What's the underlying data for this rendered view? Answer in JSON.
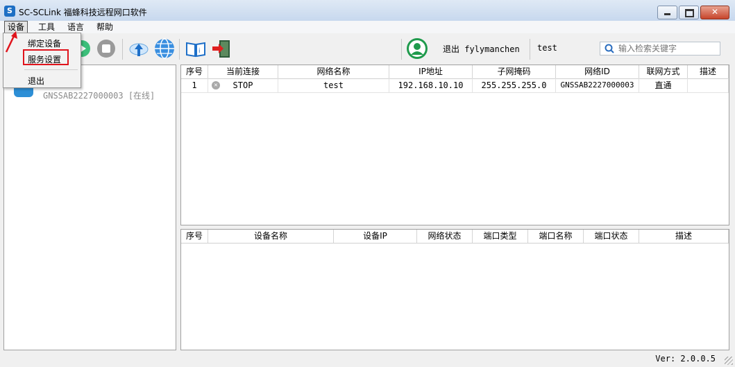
{
  "window": {
    "title": "SC-SCLink 福蜂科技远程网口软件",
    "icon_letter": "S"
  },
  "menubar": {
    "items": [
      "设备",
      "工具",
      "语言",
      "帮助"
    ]
  },
  "dropdown": {
    "items": [
      "绑定设备",
      "服务设置",
      "退出"
    ],
    "highlighted": "服务设置",
    "highlight_color": "#e0141c"
  },
  "toolbar": {
    "icons": [
      "play-icon",
      "stop-icon",
      "upload-icon",
      "globe-icon",
      "manual-icon",
      "exit-icon",
      "user-avatar-icon"
    ],
    "user_label": "退出 fylymanchen",
    "network_label": "test",
    "search_placeholder": "输入检索关键字"
  },
  "left_panel": {
    "device_text": "GNSSAB2227000003 [在线]"
  },
  "network_table": {
    "columns": [
      "序号",
      "当前连接",
      "网络名称",
      "IP地址",
      "子网掩码",
      "网络ID",
      "联网方式",
      "描述"
    ],
    "rows": [
      {
        "index": "1",
        "connection": "STOP",
        "name": "test",
        "ip": "192.168.10.10",
        "mask": "255.255.255.0",
        "network_id": "GNSSAB2227000003",
        "mode": "直通",
        "desc": ""
      }
    ]
  },
  "device_table": {
    "columns": [
      "序号",
      "设备名称",
      "设备IP",
      "网络状态",
      "端口类型",
      "端口名称",
      "端口状态",
      "描述"
    ]
  },
  "statusbar": {
    "version": "Ver: 2.0.0.5"
  }
}
